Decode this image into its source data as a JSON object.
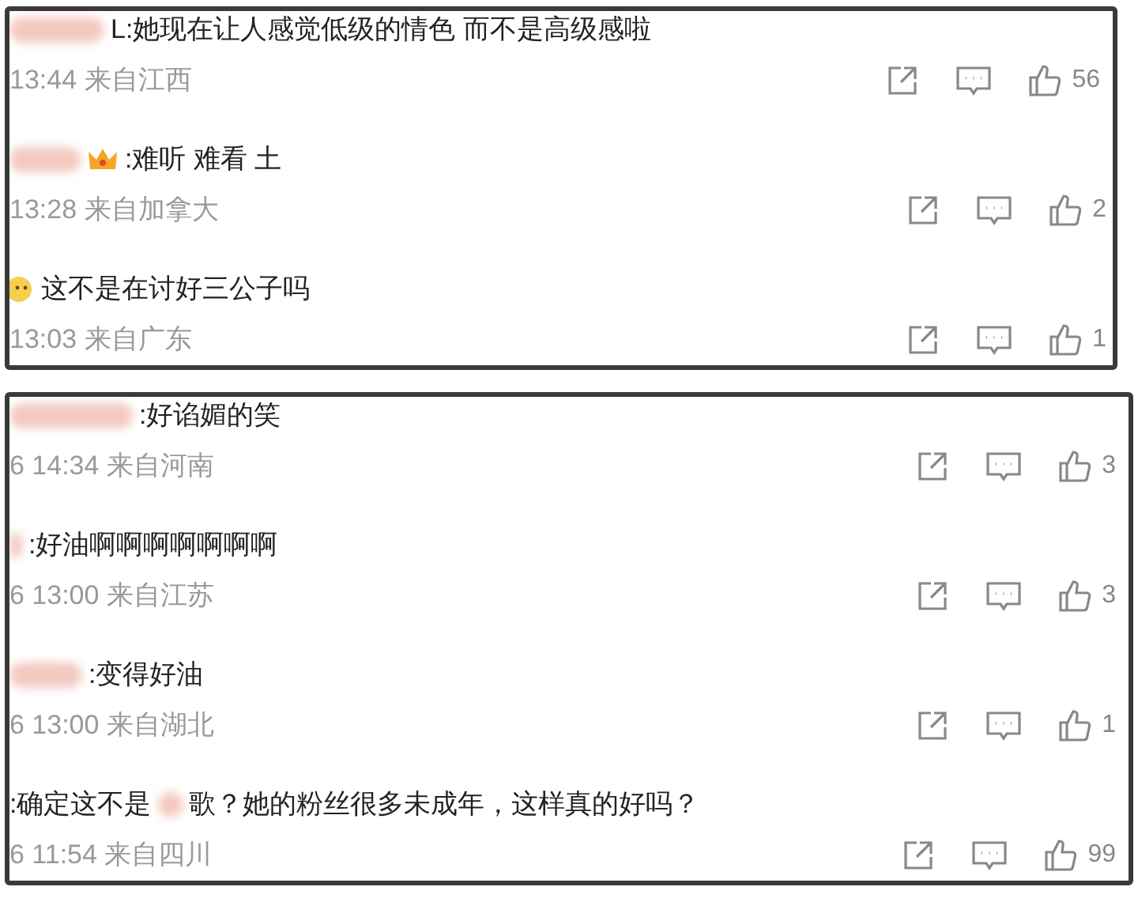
{
  "panels": [
    {
      "comments": [
        {
          "text": "L:她现在让人感觉低级的情色 而不是高级感啦",
          "time": "13:44 来自江西",
          "likes": "56"
        },
        {
          "kind": "crown",
          "text": ":难听 难看 土",
          "time": "13:28 来自加拿大",
          "likes": "2"
        },
        {
          "kind": "emoji",
          "text": "这不是在讨好三公子吗",
          "time": "13:03 来自广东",
          "likes": "1"
        }
      ]
    },
    {
      "comments": [
        {
          "text": ":好谄媚的笑",
          "time": "6 14:34 来自河南",
          "likes": "3"
        },
        {
          "text": ":好油啊啊啊啊啊啊啊",
          "time": "6 13:00 来自江苏",
          "likes": "3"
        },
        {
          "text": ":变得好油",
          "time": "6 13:00 来自湖北",
          "likes": "1"
        },
        {
          "text": ":确定这不是",
          "text_after_blur": "歌？她的粉丝很多未成年，这样真的好吗？",
          "time": "6 11:54 来自四川",
          "likes": "99"
        }
      ]
    }
  ]
}
